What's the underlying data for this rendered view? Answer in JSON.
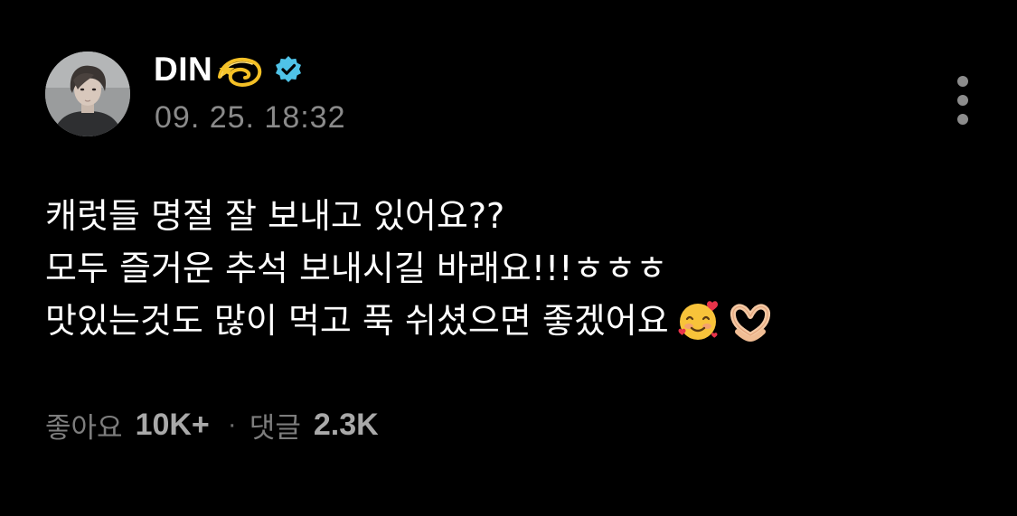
{
  "post": {
    "author": {
      "name": "DIN",
      "name_emoji": "dizzy-icon",
      "verified": true,
      "verified_color": "#4fc3e8",
      "avatar": "avatar-photo"
    },
    "timestamp": "09. 25. 18:32",
    "menu_icon": "more-vertical-icon",
    "lines": [
      {
        "text": "캐럿들 명절 잘 보내고 있어요??"
      },
      {
        "text": "모두 즐거운 추석 보내시길 바래요!!!ㅎㅎㅎ"
      },
      {
        "text": "맛있는것도 많이 먹고 푹 쉬셨으면 좋겠어요",
        "emojis": [
          "smiling-face-with-hearts-icon",
          "heart-hands-icon"
        ]
      }
    ]
  },
  "stats": {
    "likes_label": "좋아요",
    "likes_value": "10K+",
    "separator": "·",
    "comments_label": "댓글",
    "comments_value": "2.3K"
  },
  "colors": {
    "background": "#000000",
    "text": "#ffffff",
    "muted": "#8a8a8a",
    "verified": "#4fc3e8"
  }
}
